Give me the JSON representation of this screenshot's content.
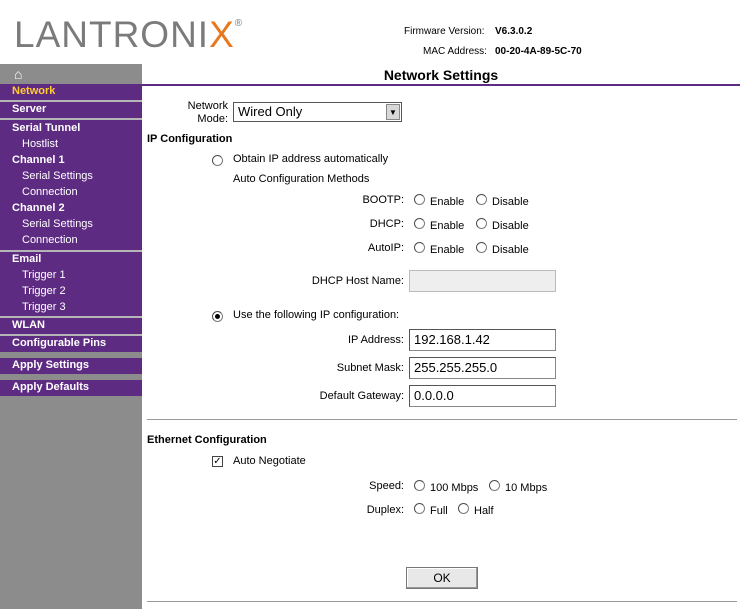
{
  "header": {
    "logo_text_main": "LANTRONI",
    "logo_text_x": "X",
    "logo_reg": "®",
    "firmware_label": "Firmware Version:",
    "firmware_value": "V6.3.0.2",
    "mac_label": "MAC Address:",
    "mac_value": "00-20-4A-89-5C-70"
  },
  "nav": {
    "home_icon": "home-icon",
    "items": {
      "network": "Network",
      "server": "Server",
      "serial_tunnel": "Serial Tunnel",
      "hostlist": "Hostlist",
      "channel1": "Channel 1",
      "ch1_serial": "Serial Settings",
      "ch1_conn": "Connection",
      "channel2": "Channel 2",
      "ch2_serial": "Serial Settings",
      "ch2_conn": "Connection",
      "email": "Email",
      "trigger1": "Trigger 1",
      "trigger2": "Trigger 2",
      "trigger3": "Trigger 3",
      "wlan": "WLAN",
      "config_pins": "Configurable Pins",
      "apply_settings": "Apply Settings",
      "apply_defaults": "Apply Defaults"
    },
    "active_color": "#ffcc33",
    "bg_color": "#5e2b82"
  },
  "main": {
    "title": "Network Settings",
    "network_mode_label_line1": "Network",
    "network_mode_label_line2": "Mode:",
    "network_mode_value": "Wired Only",
    "ip_config_title": "IP Configuration",
    "obtain_auto": "Obtain IP address automatically",
    "auto_methods": "Auto Configuration Methods",
    "bootp_label": "BOOTP:",
    "dhcp_label": "DHCP:",
    "autoip_label": "AutoIP:",
    "enable": "Enable",
    "disable": "Disable",
    "dhcp_host_label": "DHCP Host Name:",
    "dhcp_host_value": "",
    "use_following": "Use the following IP configuration:",
    "ip_label": "IP Address:",
    "ip_value": "192.168.1.42",
    "subnet_label": "Subnet Mask:",
    "subnet_value": "255.255.255.0",
    "gateway_label": "Default Gateway:",
    "gateway_value": "0.0.0.0",
    "eth_title": "Ethernet Configuration",
    "auto_negotiate": "Auto Negotiate",
    "auto_negotiate_check": "✓",
    "speed_label": "Speed:",
    "speed_100": "100 Mbps",
    "speed_10": "10 Mbps",
    "duplex_label": "Duplex:",
    "duplex_full": "Full",
    "duplex_half": "Half",
    "ok_label": "OK"
  }
}
